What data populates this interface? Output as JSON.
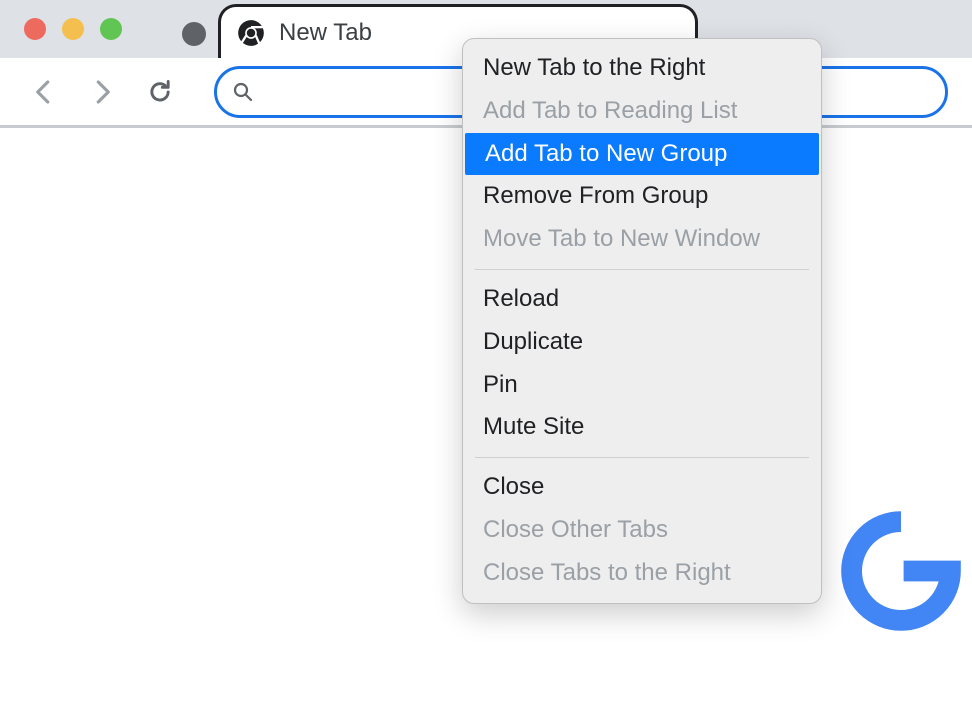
{
  "tab": {
    "title": "New Tab"
  },
  "context_menu": {
    "items": [
      {
        "label": "New Tab to the Right",
        "disabled": false,
        "highlighted": false
      },
      {
        "label": "Add Tab to Reading List",
        "disabled": true,
        "highlighted": false
      },
      {
        "label": "Add Tab to New Group",
        "disabled": false,
        "highlighted": true
      },
      {
        "label": "Remove From Group",
        "disabled": false,
        "highlighted": false
      },
      {
        "label": "Move Tab to New Window",
        "disabled": true,
        "highlighted": false
      },
      {
        "separator": true
      },
      {
        "label": "Reload",
        "disabled": false,
        "highlighted": false
      },
      {
        "label": "Duplicate",
        "disabled": false,
        "highlighted": false
      },
      {
        "label": "Pin",
        "disabled": false,
        "highlighted": false
      },
      {
        "label": "Mute Site",
        "disabled": false,
        "highlighted": false
      },
      {
        "separator": true
      },
      {
        "label": "Close",
        "disabled": false,
        "highlighted": false
      },
      {
        "label": "Close Other Tabs",
        "disabled": true,
        "highlighted": false
      },
      {
        "label": "Close Tabs to the Right",
        "disabled": true,
        "highlighted": false
      }
    ]
  },
  "colors": {
    "accent": "#1a73e8",
    "highlight": "#0a7aff",
    "google_blue": "#4285f4"
  }
}
